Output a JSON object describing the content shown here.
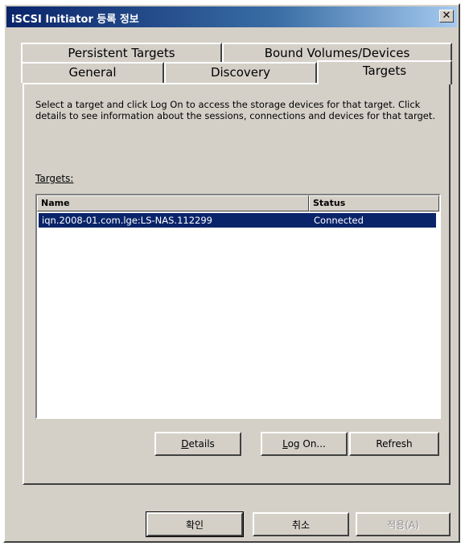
{
  "window": {
    "title": "iSCSI Initiator 등록 정보",
    "close_icon": "✕"
  },
  "tabs": {
    "row1": [
      {
        "label": "Persistent Targets"
      },
      {
        "label": "Bound Volumes/Devices"
      }
    ],
    "row2": [
      {
        "label": "General"
      },
      {
        "label": "Discovery"
      },
      {
        "label": "Targets",
        "active": true
      }
    ]
  },
  "panel": {
    "description": "Select a target and click Log On to access the storage devices for that target. Click details to see information about the sessions, connections and devices for that target.",
    "targets_label": "Targets:",
    "columns": [
      "Name",
      "Status"
    ],
    "rows": [
      {
        "name": "iqn.2008-01.com.lge:LS-NAS.112299",
        "status": "Connected",
        "selected": true
      }
    ],
    "buttons": {
      "details": "Details",
      "logon": "Log On...",
      "refresh": "Refresh"
    }
  },
  "footer": {
    "ok": "확인",
    "cancel": "취소",
    "apply": "적용(A)"
  },
  "colors": {
    "face": "#d4d0c8",
    "title_start": "#0a246a",
    "selection": "#0a246a"
  }
}
